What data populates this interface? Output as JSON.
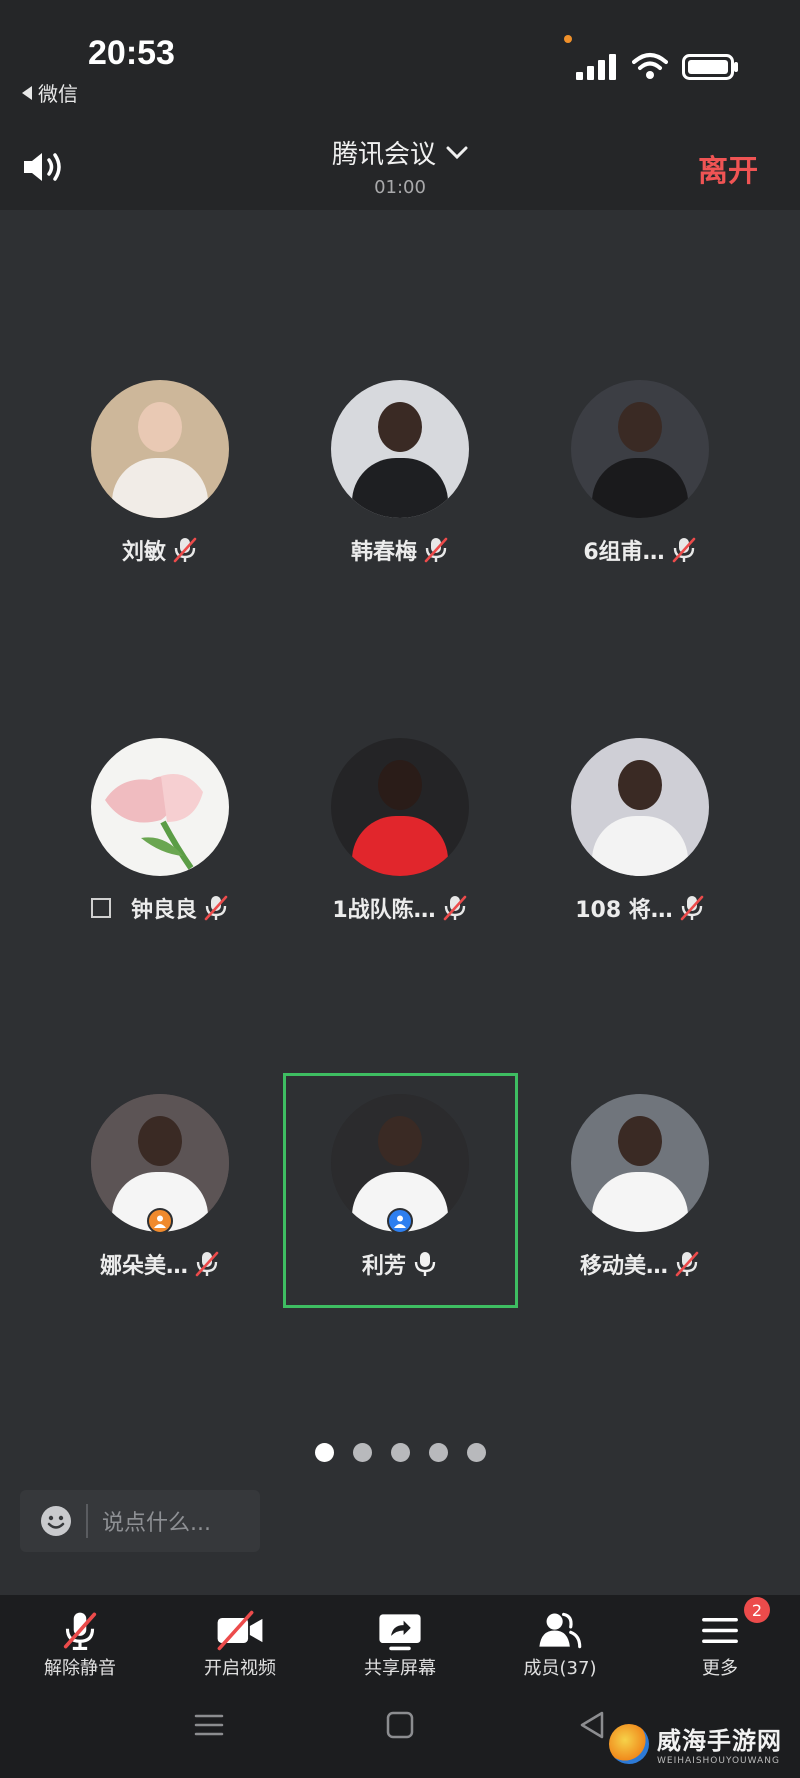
{
  "status_bar": {
    "time": "20:53",
    "back_app": "微信"
  },
  "header": {
    "title": "腾讯会议",
    "duration": "01:00",
    "leave_label": "离开"
  },
  "participants": [
    {
      "name": "刘敏",
      "mic": "muted",
      "avatar_bg": "#cdb79a",
      "avatar_fg": "#f1ece7"
    },
    {
      "name": "韩春梅",
      "mic": "muted",
      "avatar_bg": "#d7d9dd",
      "avatar_fg": "#1e1f22"
    },
    {
      "name": "6组甫…",
      "mic": "muted",
      "avatar_bg": "#3c3e44",
      "avatar_fg": "#1a1a1c"
    },
    {
      "name": "钟良良",
      "mic": "muted",
      "avatar_bg": "#f4f4f2",
      "avatar_fg": "#f0bfc0"
    },
    {
      "name": "1战队陈…",
      "mic": "muted",
      "avatar_bg": "#242426",
      "avatar_fg": "#e1262c"
    },
    {
      "name": "108 将…",
      "mic": "muted",
      "avatar_bg": "#cfcfd6",
      "avatar_fg": "#f3f3f3"
    },
    {
      "name": "娜朵美…",
      "mic": "muted",
      "avatar_bg": "#5c5455",
      "avatar_fg": "#f5f5f5"
    },
    {
      "name": "利芳",
      "mic": "on",
      "avatar_bg": "#2b2b2d",
      "avatar_fg": "#f5f5f5"
    },
    {
      "name": "移动美…",
      "mic": "muted",
      "avatar_bg": "#70757c",
      "avatar_fg": "#f5f5f5"
    }
  ],
  "chat": {
    "placeholder": "说点什么..."
  },
  "toolbar": {
    "unmute": "解除静音",
    "video": "开启视频",
    "share": "共享屏幕",
    "members": "成员(37)",
    "more": "更多",
    "more_badge": "2"
  },
  "watermark": {
    "main": "威海手游网",
    "sub": "WEIHAISHOUYOUWANG"
  },
  "colors": {
    "leave": "#f05454",
    "active_speaker": "#3ebd62",
    "stage": "#2e3033",
    "badge_blue": "#2d7ff0",
    "badge_orange": "#f08a2c"
  }
}
